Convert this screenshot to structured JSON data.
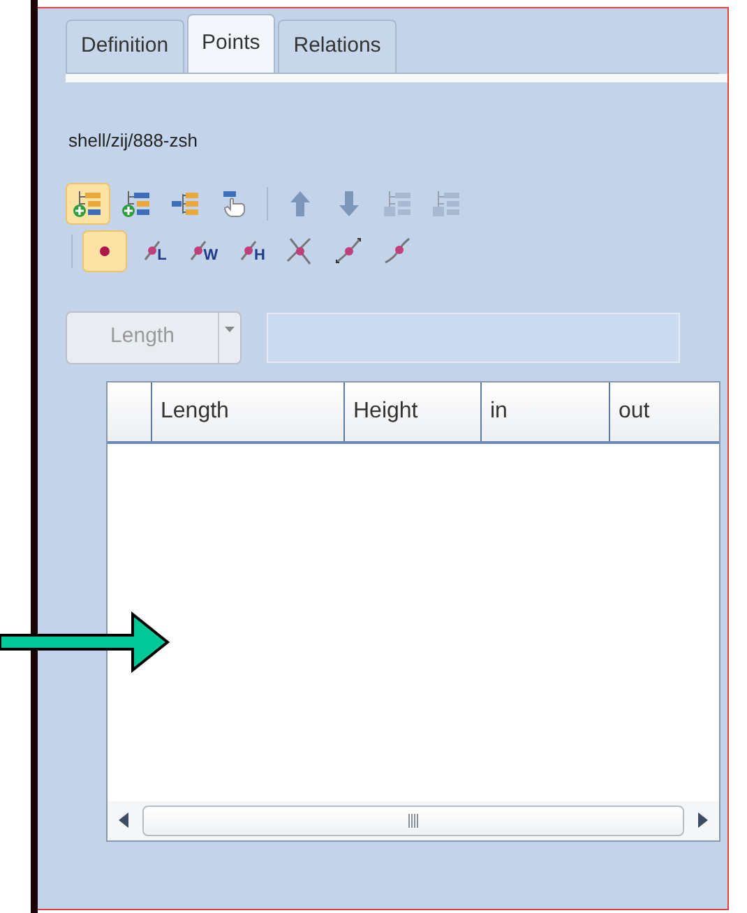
{
  "tabs": [
    {
      "label": "Definition",
      "selected": false
    },
    {
      "label": "Points",
      "selected": true
    },
    {
      "label": "Relations",
      "selected": false
    }
  ],
  "path": "shell/zij/888-zsh",
  "toolbar_1": [
    {
      "kind": "tree-add",
      "selected": true,
      "disabled": false
    },
    {
      "kind": "tree-add-child",
      "selected": false,
      "disabled": false
    },
    {
      "kind": "tree",
      "selected": false,
      "disabled": false
    },
    {
      "kind": "hand",
      "selected": false,
      "disabled": false
    },
    {
      "kind": "separator"
    },
    {
      "kind": "up",
      "selected": false,
      "disabled": false
    },
    {
      "kind": "down",
      "selected": false,
      "disabled": false
    },
    {
      "kind": "tree-remove",
      "selected": false,
      "disabled": true
    },
    {
      "kind": "tree-remove-all",
      "selected": false,
      "disabled": true
    }
  ],
  "toolbar_2": [
    {
      "kind": "separator"
    },
    {
      "kind": "point",
      "selected": true
    },
    {
      "kind": "point-letter",
      "letter": "L",
      "selected": false
    },
    {
      "kind": "point-letter",
      "letter": "W",
      "selected": false
    },
    {
      "kind": "point-letter",
      "letter": "H",
      "selected": false
    },
    {
      "kind": "cross",
      "selected": false
    },
    {
      "kind": "curve-arrows",
      "selected": false
    },
    {
      "kind": "curve",
      "selected": false
    }
  ],
  "combo": {
    "value": "Length",
    "disabled": true
  },
  "text_field": {
    "disabled": true
  },
  "table": {
    "columns": [
      "Length",
      "Height",
      "in",
      "out"
    ]
  }
}
